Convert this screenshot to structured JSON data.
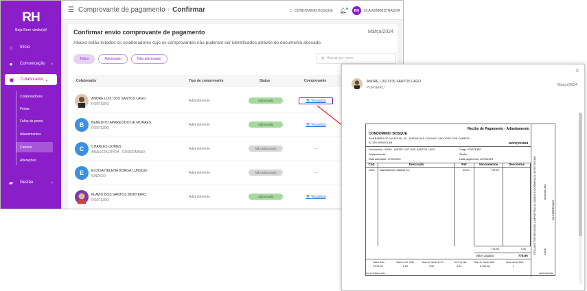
{
  "sidebar": {
    "logo": "RH",
    "welcome": "Seja Bem vindo(a)!",
    "items": [
      {
        "label": "Início",
        "icon": "home-icon"
      },
      {
        "label": "Comunicação",
        "icon": "chat-icon",
        "chevron": ">"
      },
      {
        "label": "Colaborador",
        "icon": "id-card-icon",
        "chevron": "v"
      },
      {
        "label": "Gestão",
        "icon": "briefcase-icon",
        "chevron": ">"
      }
    ],
    "subitems": [
      "Colaboradores",
      "Férias",
      "Folha de ponto",
      "Afastamentos",
      "Carteira",
      "Alterações"
    ]
  },
  "topbar": {
    "breadcrumb_parent": "Comprovante de pagamento",
    "breadcrumb_current": "Confirmar",
    "company": "CONDOMINIO BOSQUE",
    "avatar_initials": "RH",
    "greeting": "OLÁ ADMINISTRADOR"
  },
  "page": {
    "title": "Confirmar envio comprovante de pagamento",
    "month": "Março/2024",
    "description": "Abaixo estão listados os colaboradores cujo os comprovantes não puderam ser identificados através do documento anexado.",
    "filters": [
      "Todos",
      "Adicionado",
      "Não adicionado"
    ],
    "search_placeholder": "Buscar por nome"
  },
  "table": {
    "headers": [
      "Colaborador",
      "Tipo de comprovante",
      "Status",
      "Comprovante"
    ],
    "rows": [
      {
        "initial": "",
        "name": "ANDRE LUIZ DOS SANTOS LAGO",
        "role": "PORTEIRO",
        "tipo": "Adiantamento",
        "status": "Adicionado",
        "comprovante": "Visualizar"
      },
      {
        "initial": "B",
        "name": "BENEDITO APARECIDO DE MORAES",
        "role": "PORTEIRO",
        "tipo": "Adiantamento",
        "status": "Adicionado",
        "comprovante": "Visualizar"
      },
      {
        "initial": "C",
        "name": "CHARLES GOMES",
        "role": "ANALISTA DP/RH - CONDOMÍNIO",
        "tipo": "Adiantamento",
        "status": "Não adicionado",
        "comprovante": "---"
      },
      {
        "initial": "E",
        "name": "ELOISA HELENA BORGA LUNSQUI",
        "role": "SÍNDICO",
        "tipo": "Adiantamento",
        "status": "Não adicionado",
        "comprovante": "---"
      },
      {
        "initial": "",
        "name": "FLAVIO DOS SANTOS MONTEIRO",
        "role": "PORTEIRO",
        "tipo": "Adiantamento",
        "status": "Adicionado",
        "comprovante": "Visualizar"
      }
    ]
  },
  "modal": {
    "close": "X",
    "name": "ANDRE LUIZ DOS SANTOS LAGO",
    "role": "PORTEIRO",
    "month": "Março/2024"
  },
  "receipt": {
    "title": "Recibo de Pagamento - Adiantamento",
    "company": "CONDOMINIO BOSQUE",
    "address": "RUA BARÃO DE JACEGUAI, 30 - JARDIM DAS COLINAS, SAO JOSE DOS CAMPOS",
    "cnpj": "52.316.925/0001-88",
    "month": "MARÇO/2024",
    "employee": "Funcionário : 00048 - ANDRE LUIZ DOS SANTOS LAGO",
    "department": "Departamento:",
    "admission": "Data admissão: 17/02/2023",
    "cargo": "Cargo: PORTEIRO",
    "secao": "Seção:",
    "payment_date": "Data pagamento: 20/03/2024",
    "headers": [
      "Cód.",
      "Descrição",
      "Ref.",
      "Vencimentos",
      "Descontos"
    ],
    "item": {
      "code": "1000",
      "desc": "Adiantamento Salarial (C)",
      "ref": "40,00",
      "venc": "778,96"
    },
    "total_venc": "778,96",
    "total_desc": "0,00",
    "valor_liquido_label": "Valor Líquido",
    "valor_liquido": "778,96",
    "footer_labels": [
      "Salário Base",
      "Salário Contr. INSS",
      "Base de Cálculo FGTS",
      "FGTS do Mês",
      "Base de Cálculo IRRF",
      "Dependentes IRRF"
    ],
    "footer_values": [
      "1.947,40",
      "0,00",
      "0,00",
      "0,00",
      "2.161,64",
      "1"
    ],
    "software": "Group Software Ltda",
    "software_right": "apiRecibePagto",
    "side_text": "DECLARO TER RECEBIDO A IMPORTÂNCIA LÍQUIDA DISCRIMINADA NESTE RECIBO",
    "side_sig": "ASSINATURA",
    "side_func": "DO EMPREGADO",
    "side_date": "DATA"
  },
  "colors": {
    "brand": "#8a1fc9",
    "arrow": "#e02020"
  }
}
